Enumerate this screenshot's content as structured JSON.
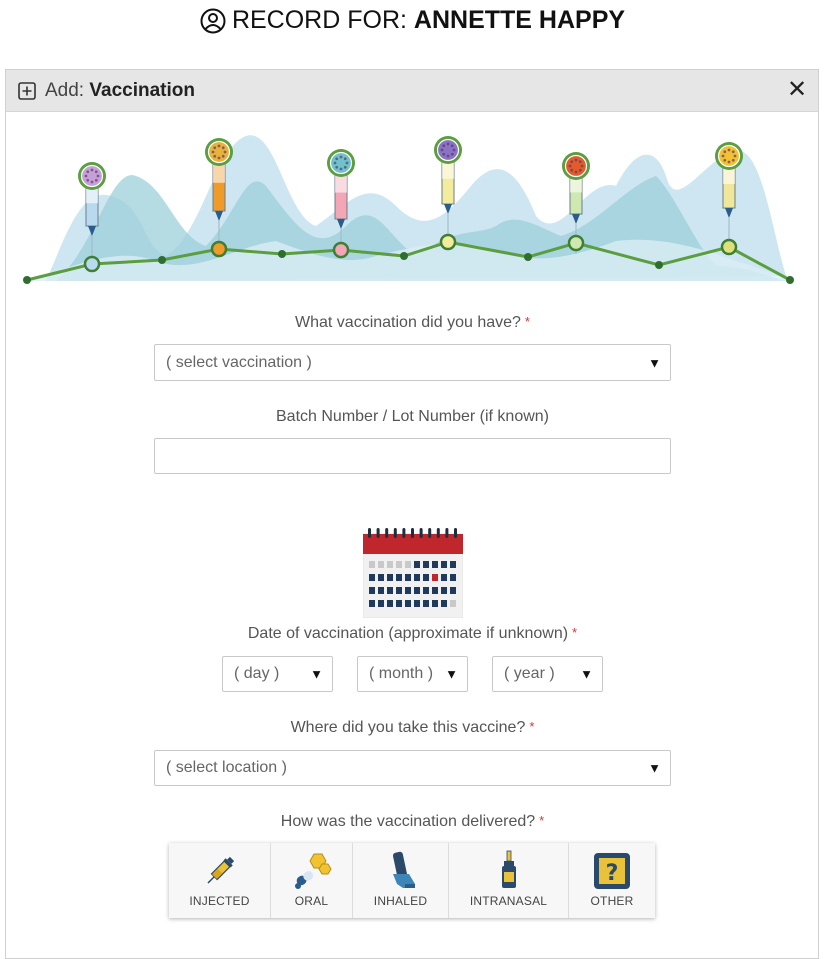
{
  "record": {
    "prefix": "RECORD FOR: ",
    "name": "ANNETTE HAPPY"
  },
  "panel": {
    "title_prefix": "Add: ",
    "title": "Vaccination",
    "close_label": "✕"
  },
  "form": {
    "vaccination": {
      "label": "What vaccination did you have?",
      "required_mark": "*",
      "placeholder": "( select vaccination )"
    },
    "batch": {
      "label": "Batch Number / Lot Number (if known)",
      "value": ""
    },
    "date": {
      "label": "Date of vaccination (approximate if unknown)",
      "required_mark": "*",
      "day": "( day )",
      "month": "( month )",
      "year": "( year )"
    },
    "location": {
      "label": "Where did you take this vaccine?",
      "required_mark": "*",
      "placeholder": "( select location )"
    },
    "delivery": {
      "label": "How was the vaccination delivered?",
      "required_mark": "*",
      "options": [
        "INJECTED",
        "ORAL",
        "INHALED",
        "INTRANASAL",
        "OTHER"
      ]
    }
  },
  "dropdown_arrow": "▼",
  "colors": {
    "accent_green": "#5a9e3f",
    "calendar_red": "#c0272d",
    "panel_header": "#e6e6e6"
  }
}
